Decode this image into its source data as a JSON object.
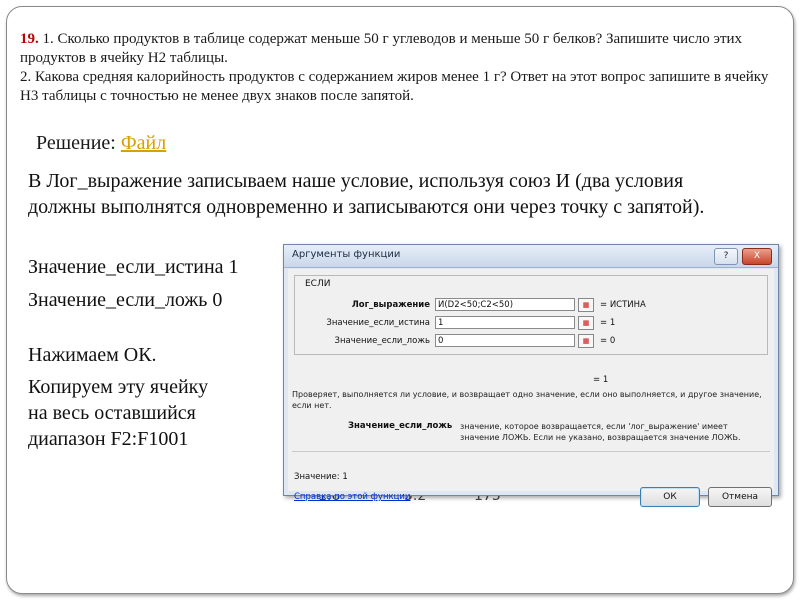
{
  "task": {
    "number": "19.",
    "text1": " 1. Сколько продуктов в таблице содержат меньше 50 г углеводов и меньше 50 г белков? Запишите число этих продуктов в ячейку Н2 таблицы.",
    "text2": "2. Какова средняя калорийность продуктов с содержанием жиров менее 1 г? Ответ на этот вопрос запишите в ячейку Н3 таблицы с точностью не менее двух знаков после запятой."
  },
  "solution": {
    "label": "Решение: ",
    "link": "Файл"
  },
  "explain": "В Лог_выражение записываем наше условие, используя союз И (два условия должны выполнятся одновременно и записываются они через точку с запятой).",
  "lines": {
    "true_value": "Значение_если_истина 1",
    "false_value": "Значение_если_ложь 0",
    "press_ok": "Нажимаем ОК.",
    "copy1": "Копируем эту ячейку",
    "copy2": "на весь оставшийся",
    "copy3": "диапазон F2:F1001"
  },
  "background_numbers": [
    "1.6",
    "5.2",
    "175"
  ],
  "dialog": {
    "title": "Аргументы функции",
    "window_buttons": {
      "help": "?",
      "close": "X"
    },
    "function_name": "ЕСЛИ",
    "args": [
      {
        "label": "Лог_выражение",
        "value": "И(D2<50;C2<50)",
        "result": "=  ИСТИНА"
      },
      {
        "label": "Значение_если_истина",
        "value": "1",
        "result": "=  1"
      },
      {
        "label": "Значение_если_ложь",
        "value": "0",
        "result": "=  0"
      }
    ],
    "total_result": "=  1",
    "description": "Проверяет, выполняется ли условие, и возвращает одно значение, если оно выполняется, и другое значение, если нет.",
    "arg_name": "Значение_если_ложь",
    "arg_description": "значение, которое возвращается, если 'лог_выражение' имеет значение ЛОЖЬ. Если не указано, возвращается значение ЛОЖЬ.",
    "value_line": "Значение:  1",
    "help_link": "Справка по этой функции",
    "ok": "ОК",
    "cancel": "Отмена"
  },
  "colors": {
    "task_number": "#c00000",
    "solution_link": "#d8a000",
    "help_link": "#0033cc"
  }
}
